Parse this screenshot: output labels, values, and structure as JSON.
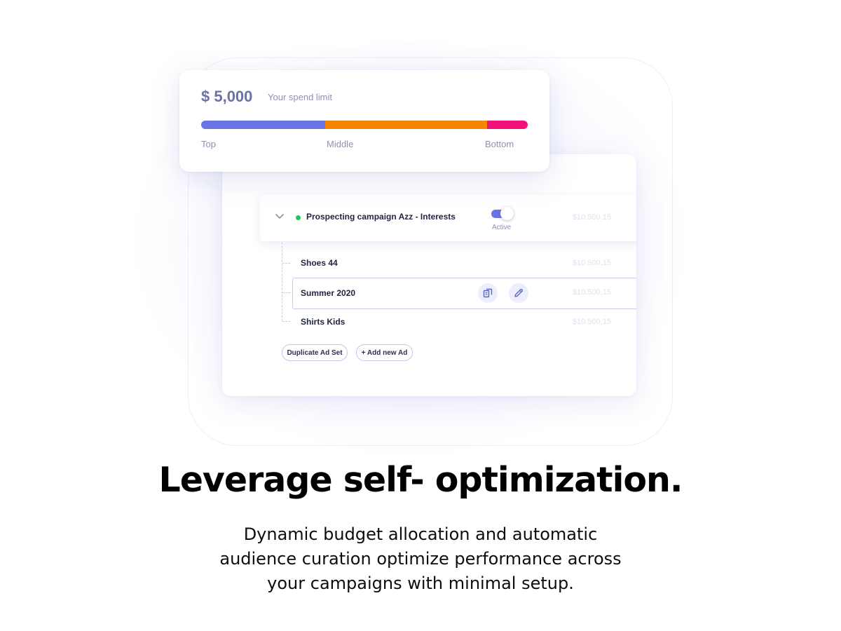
{
  "spend_card": {
    "amount": "$ 5,000",
    "caption": "Your spend limit",
    "segments": [
      {
        "name": "Top",
        "fraction": 0.38,
        "color": "#6a74e6"
      },
      {
        "name": "Middle",
        "fraction": 0.495,
        "color": "#f58500"
      },
      {
        "name": "Bottom",
        "fraction": 0.125,
        "color": "#f0127a"
      }
    ],
    "labels": {
      "top": "Top",
      "middle": "Middle",
      "bottom": "Bottom"
    }
  },
  "campaign": {
    "name": "Prospecting campaign Azz - Interests",
    "status": "Active",
    "status_on": true,
    "status_dot_color": "#22c55e",
    "amount": "$10.500,15",
    "ads": [
      {
        "name": "Shoes 44",
        "amount": "$10.500,15"
      },
      {
        "name": "Summer 2020",
        "amount": "$10.500,15",
        "selected": true
      },
      {
        "name": "Shirts Kids",
        "amount": "$10.500,15"
      }
    ]
  },
  "actions": {
    "duplicate_label": "Duplicate Ad Set",
    "add_label": "+ Add new Ad",
    "copy_icon": "copy-icon",
    "edit_icon": "pencil-icon"
  },
  "hero": {
    "headline": "Leverage self- optimization.",
    "body": "Dynamic budget allocation and automatic audience curation optimize performance across your campaigns with minimal setup."
  },
  "colors": {
    "accent": "#6a74e6",
    "orange": "#f58500",
    "pink": "#f0127a"
  }
}
